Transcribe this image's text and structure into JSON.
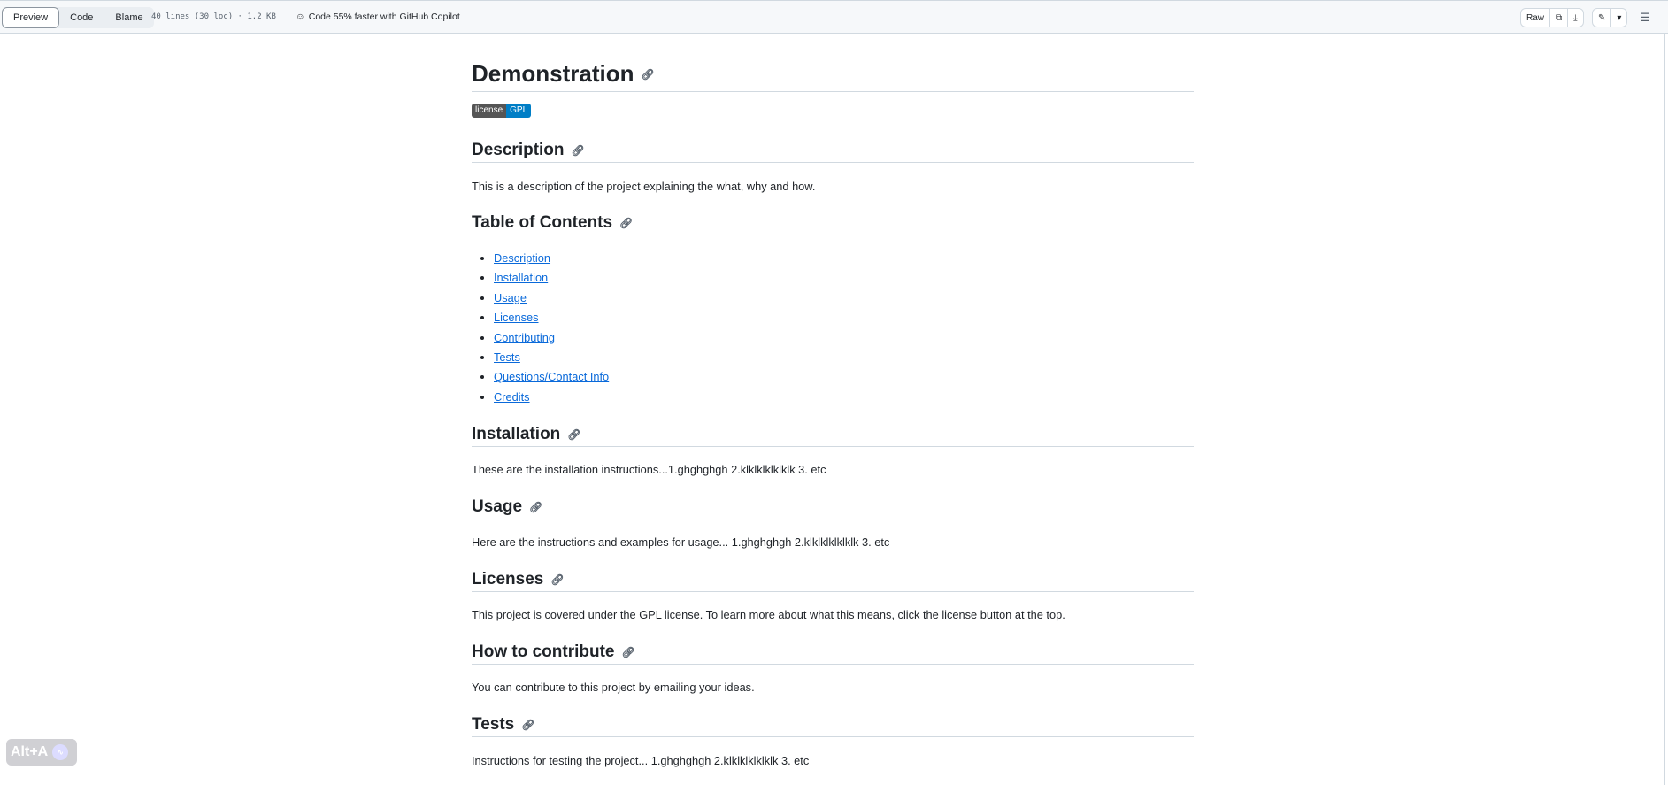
{
  "toolbar": {
    "tabs": [
      "Preview",
      "Code",
      "Blame"
    ],
    "file_meta": "40 lines (30 loc) · 1.2 KB",
    "copilot": "Code 55% faster with GitHub Copilot",
    "raw": "Raw"
  },
  "doc": {
    "title": "Demonstration",
    "badge": {
      "label": "license",
      "value": "GPL",
      "label_color": "#555555",
      "value_color": "#007ec6"
    },
    "sections": [
      {
        "heading": "Description",
        "text": "This is a description of the project explaining the what, why and how."
      },
      {
        "heading": "Table of Contents"
      },
      {
        "heading": "Installation",
        "text": "These are the installation instructions...1.ghghghgh 2.klklklklklklk 3. etc"
      },
      {
        "heading": "Usage",
        "text": "Here are the instructions and examples for usage... 1.ghghghgh 2.klklklklklklk 3. etc"
      },
      {
        "heading": "Licenses",
        "text": "This project is covered under the GPL license. To learn more about what this means, click the license button at the top."
      },
      {
        "heading": "How to contribute",
        "text": "You can contribute to this project by emailing your ideas."
      },
      {
        "heading": "Tests",
        "text": "Instructions for testing the project... 1.ghghghgh 2.klklklklklklk 3. etc"
      }
    ],
    "toc": [
      "Description",
      "Installation",
      "Usage",
      "Licenses",
      "Contributing",
      "Tests",
      "Questions/Contact Info",
      "Credits"
    ]
  },
  "overlay": {
    "shortcut": "Alt+A"
  },
  "colors": {
    "link": "#0969da",
    "border": "#d1d9e0"
  }
}
